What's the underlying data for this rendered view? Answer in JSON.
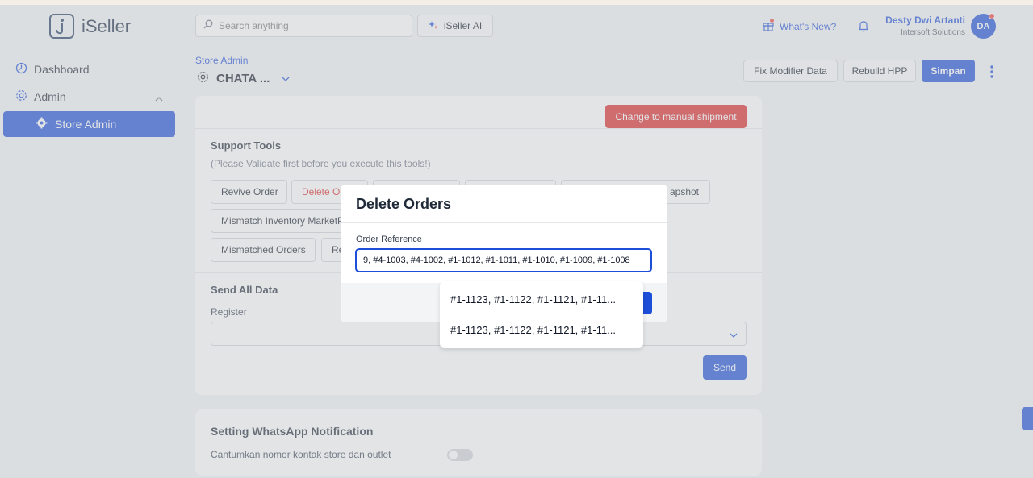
{
  "app": {
    "name": "iSeller"
  },
  "header": {
    "search_placeholder": "Search anything",
    "ai_button": "iSeller AI",
    "whats_new": "What's New?",
    "user_name": "Desty Dwi Artanti",
    "user_org": "Intersoft Solutions",
    "avatar_initials": "DA"
  },
  "sidebar": {
    "items": [
      {
        "label": "Dashboard"
      },
      {
        "label": "Admin"
      },
      {
        "label": "Store Admin"
      }
    ]
  },
  "page": {
    "breadcrumb": "Store Admin",
    "title": "CHATA ...",
    "buttons": {
      "fix_modifier": "Fix Modifier Data",
      "rebuild_hpp": "Rebuild HPP",
      "save": "Simpan"
    }
  },
  "main": {
    "manual_shipment": "Change to manual shipment",
    "support_tools": {
      "title": "Support Tools",
      "subtitle": "(Please Validate first before you execute this tools!)",
      "tools": [
        "Revive Order",
        "Delete O",
        "Mismatch Inventory MarketP",
        "Mismatched Orders",
        "Re",
        "apshot"
      ]
    },
    "send_all": {
      "title": "Send All Data",
      "register_label": "Register",
      "send": "Send"
    },
    "whatsapp": {
      "title": "Setting WhatsApp Notification",
      "contact_label": "Cantumkan nomor kontak store dan outlet"
    }
  },
  "modal": {
    "title": "Delete Orders",
    "field_label": "Order Reference",
    "field_value": "9, #4-1003, #4-1002, #1-1012, #1-1011, #1-1010, #1-1009, #1-1008",
    "suggestions": [
      "#1-1123, #1-1122, #1-1121, #1-11...",
      "#1-1123, #1-1122, #1-1121, #1-11..."
    ]
  },
  "colors": {
    "primary": "#1d4ed8",
    "danger": "#dc2626"
  }
}
